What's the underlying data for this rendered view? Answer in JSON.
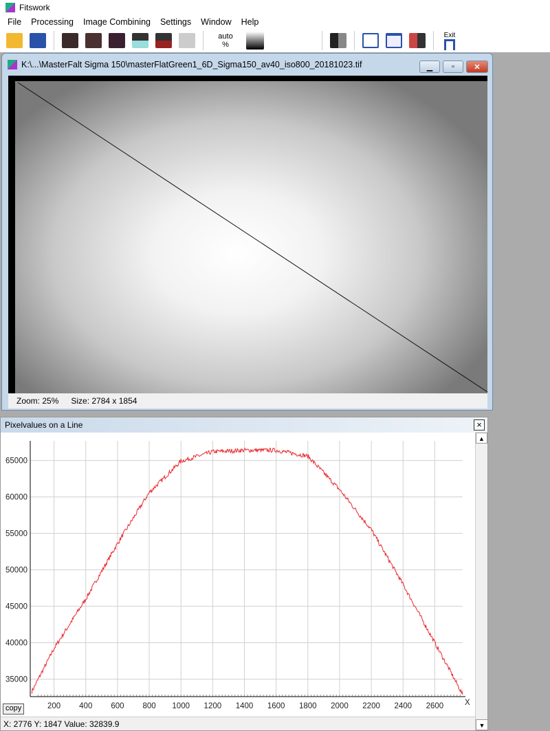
{
  "app": {
    "title": "Fitswork"
  },
  "menu": [
    "File",
    "Processing",
    "Image Combining",
    "Settings",
    "Window",
    "Help"
  ],
  "toolbar": {
    "auto_label": "auto",
    "percent_label": "%",
    "exit_label": "Exit",
    "icons": [
      "open-folder-icon",
      "save-icon",
      "flip-horizontal-icon",
      "flip-vertical-icon",
      "rotate-icon",
      "copy-image-icon",
      "duplicate-image-icon",
      "cut-icon",
      "gradient-icon",
      "star-select-icon",
      "histogram-icon",
      "window-list-icon",
      "text-annotate-icon",
      "exit-icon"
    ]
  },
  "image_window": {
    "title": "K:\\...\\MasterFalt Sigma 150\\masterFlatGreen1_6D_Sigma150_av40_iso800_20181023.tif",
    "zoom": "Zoom: 25%",
    "size": "Size: 2784 x 1854"
  },
  "panel": {
    "title": "Pixelvalues on a Line",
    "copy_label": "copy",
    "close_label": "×",
    "status": "X: 2776  Y: 1847  Value: 32839.9"
  },
  "chart_data": {
    "type": "line",
    "title": "Pixelvalues on a Line",
    "xlabel": "X",
    "ylabel": "",
    "xlim": [
      50,
      2776
    ],
    "ylim": [
      32600,
      67700
    ],
    "xticks": [
      200,
      400,
      600,
      800,
      1000,
      1200,
      1400,
      1600,
      1800,
      2000,
      2200,
      2400,
      2600
    ],
    "yticks": [
      35000,
      40000,
      45000,
      50000,
      55000,
      60000,
      65000
    ],
    "grid": true,
    "color": "#e8282e",
    "series": [
      {
        "x": [
          60,
          200,
          400,
          600,
          800,
          1000,
          1200,
          1400,
          1600,
          1800,
          2000,
          2200,
          2400,
          2600,
          2700,
          2776
        ],
        "values": [
          33300,
          39200,
          46000,
          53600,
          60600,
          64900,
          66200,
          66400,
          66400,
          65600,
          61000,
          55500,
          48000,
          40000,
          36000,
          32840
        ]
      }
    ]
  }
}
